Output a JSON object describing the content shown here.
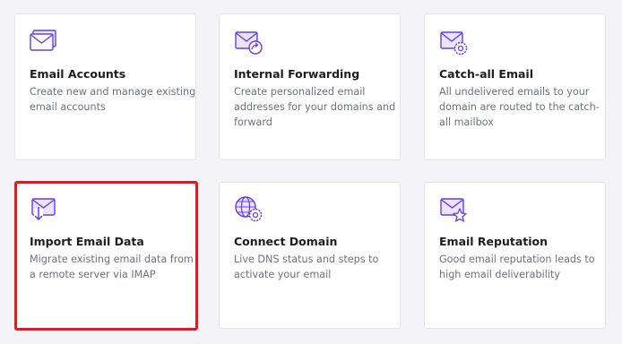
{
  "cards": [
    {
      "title": "Email Accounts",
      "description": [
        "Create new and manage existing",
        "email accounts"
      ],
      "icon": "envelopes-icon"
    },
    {
      "title": "Internal Forwarding",
      "description": [
        "Create personalized email",
        "addresses for your domains and",
        "forward"
      ],
      "icon": "envelope-forward-icon"
    },
    {
      "title": "Catch-all Email",
      "description": [
        "All undelivered emails to your",
        "domain are routed to the catch-",
        "all mailbox"
      ],
      "icon": "envelope-gear-icon"
    },
    {
      "title": "Import Email Data",
      "description": [
        "Migrate existing email data from",
        "a remote server via IMAP"
      ],
      "icon": "envelope-import-icon"
    },
    {
      "title": "Connect Domain",
      "description": [
        "Live DNS status and steps to",
        "activate your email"
      ],
      "icon": "globe-gear-icon"
    },
    {
      "title": "Email Reputation",
      "description": [
        "Good email reputation leads to",
        "high email deliverability"
      ],
      "icon": "envelope-star-icon"
    }
  ],
  "colors": {
    "icon_purple": "#673de6",
    "icon_fill": "#ebe4ff",
    "highlight": "#e01b1b"
  }
}
